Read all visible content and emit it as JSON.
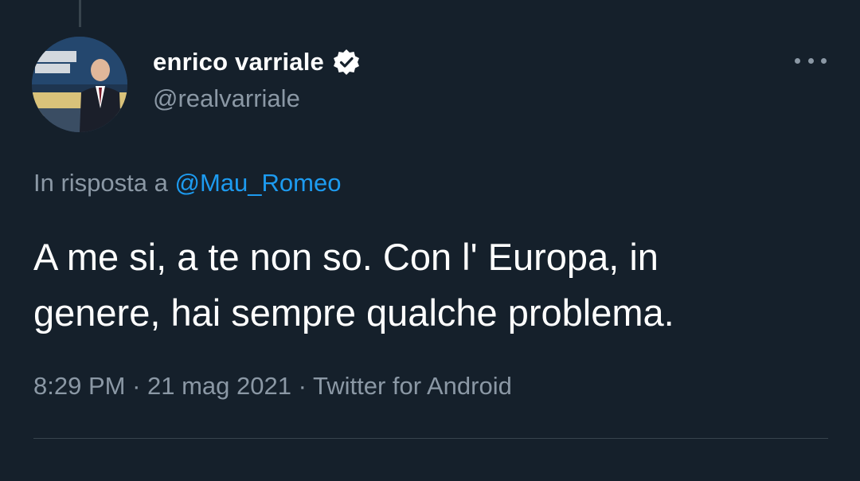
{
  "tweet": {
    "author": {
      "display_name": "enrico varriale",
      "handle": "@realvarriale",
      "verified": true,
      "avatar_icon": "profile-photo"
    },
    "reply_to": {
      "prefix": "In risposta a ",
      "mention": "@Mau_Romeo"
    },
    "text_line1": "A me si, a te non so. Con l' Europa, in",
    "text_line2": "genere, hai sempre qualche problema.",
    "meta": {
      "time": "8:29 PM",
      "separator": " · ",
      "date": "21 mag 2021",
      "source": "Twitter for Android"
    },
    "more_icon": "more-horizontal-icon"
  },
  "colors": {
    "background": "#15202b",
    "text_primary": "#ffffff",
    "text_secondary": "#8b98a5",
    "link": "#1d9bf0",
    "divider": "#38444d"
  }
}
